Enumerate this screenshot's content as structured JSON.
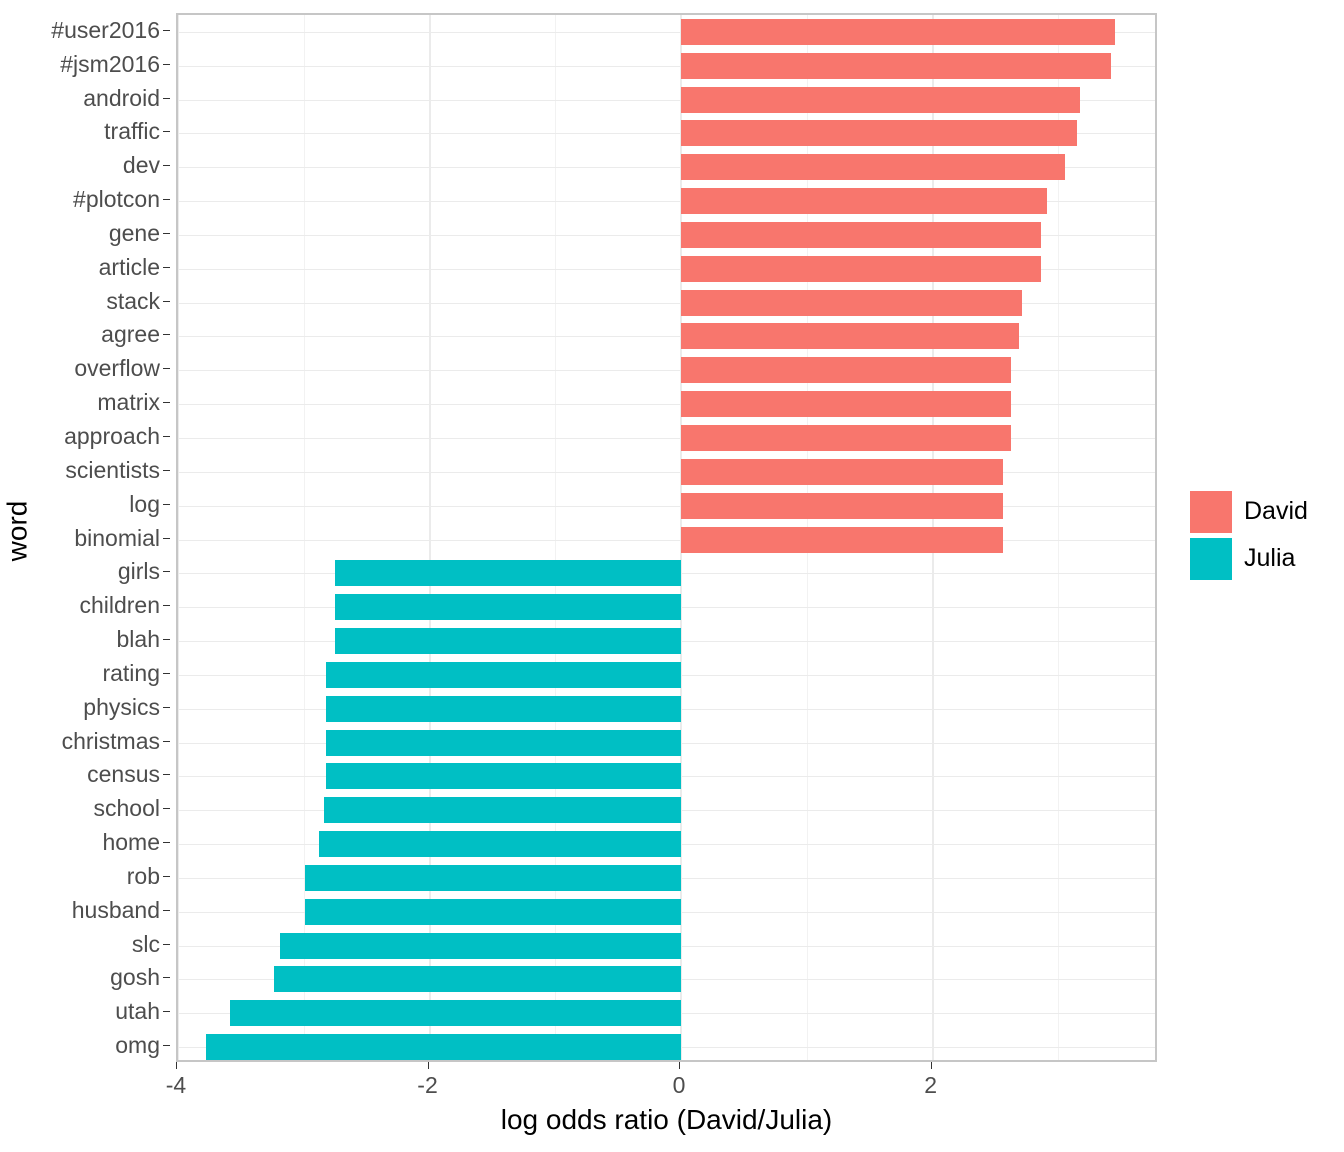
{
  "chart_data": {
    "type": "bar",
    "orientation": "horizontal",
    "title": "",
    "xlabel": "log odds ratio (David/Julia)",
    "ylabel": "word",
    "xlim": [
      -4.0,
      3.8
    ],
    "xticks": [
      -4,
      -2,
      0,
      2
    ],
    "xtick_labels": [
      "-4",
      "-2",
      "0",
      "2"
    ],
    "grid": true,
    "legend_position": "right",
    "categories": [
      "#user2016",
      "#jsm2016",
      "android",
      "traffic",
      "dev",
      "#plotcon",
      "gene",
      "article",
      "stack",
      "agree",
      "overflow",
      "matrix",
      "approach",
      "scientists",
      "log",
      "binomial",
      "girls",
      "children",
      "blah",
      "rating",
      "physics",
      "christmas",
      "census",
      "school",
      "home",
      "rob",
      "husband",
      "slc",
      "gosh",
      "utah",
      "omg"
    ],
    "values": [
      3.45,
      3.42,
      3.17,
      3.15,
      3.05,
      2.91,
      2.86,
      2.86,
      2.71,
      2.69,
      2.62,
      2.62,
      2.62,
      2.56,
      2.56,
      2.56,
      -2.75,
      -2.75,
      -2.75,
      -2.82,
      -2.82,
      -2.82,
      -2.82,
      -2.84,
      -2.88,
      -2.99,
      -2.99,
      -3.19,
      -3.24,
      -3.59,
      -3.78
    ],
    "groups": [
      "David",
      "David",
      "David",
      "David",
      "David",
      "David",
      "David",
      "David",
      "David",
      "David",
      "David",
      "David",
      "David",
      "David",
      "David",
      "David",
      "Julia",
      "Julia",
      "Julia",
      "Julia",
      "Julia",
      "Julia",
      "Julia",
      "Julia",
      "Julia",
      "Julia",
      "Julia",
      "Julia",
      "Julia",
      "Julia",
      "Julia"
    ],
    "legend": [
      {
        "name": "David",
        "color": "#F8766D"
      },
      {
        "name": "Julia",
        "color": "#00BFC4"
      }
    ],
    "colors": {
      "David": "#F8766D",
      "Julia": "#00BFC4"
    }
  }
}
